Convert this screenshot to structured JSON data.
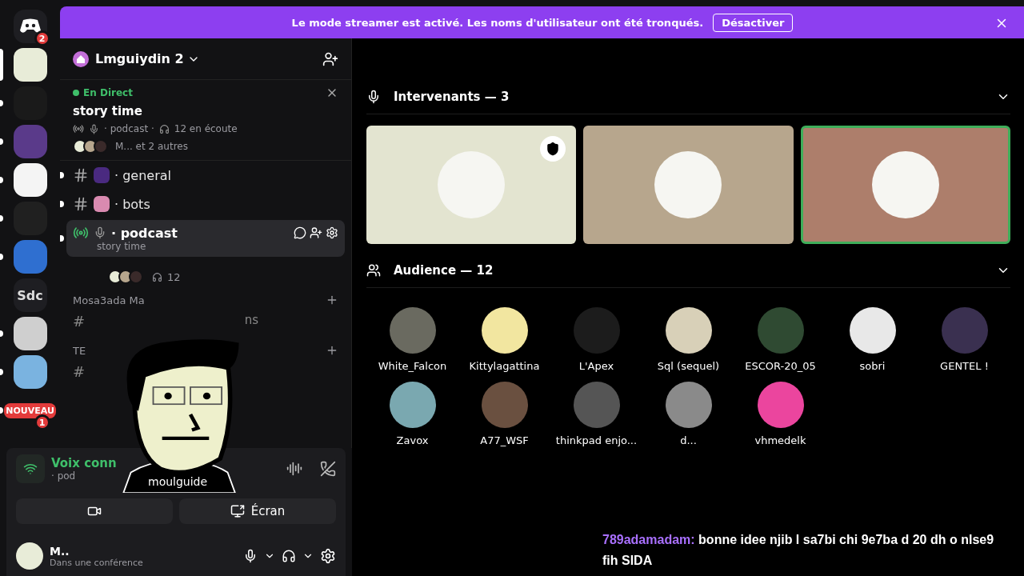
{
  "banner": {
    "text": "Le mode streamer est activé. Les noms d'utilisateur ont été tronqués.",
    "button": "Désactiver"
  },
  "servers": [
    {
      "kind": "home",
      "badge": "2",
      "unread": false,
      "selected": false
    },
    {
      "kind": "image",
      "color": "#e8ecd8",
      "unread": false,
      "selected": true
    },
    {
      "kind": "image",
      "color": "#1a1a1a",
      "unread": true,
      "selected": false
    },
    {
      "kind": "image",
      "color": "#5a3a8a",
      "unread": true,
      "selected": false
    },
    {
      "kind": "image",
      "color": "#f4f4f4",
      "unread": true,
      "selected": false
    },
    {
      "kind": "image",
      "color": "#202020",
      "unread": true,
      "selected": false
    },
    {
      "kind": "image",
      "color": "#2f6fd0",
      "unread": true,
      "selected": false
    },
    {
      "kind": "text",
      "label": "Sdc",
      "unread": false,
      "selected": false
    },
    {
      "kind": "image",
      "color": "#cfcfcf",
      "unread": true,
      "selected": false
    },
    {
      "kind": "image",
      "color": "#7ab3e0",
      "unread": true,
      "selected": false
    },
    {
      "kind": "new",
      "label": "NOUVEAU",
      "badge": "1",
      "unread": true,
      "selected": false
    }
  ],
  "sidebar": {
    "server_name": "Lmguiydin 2",
    "live": {
      "status": "En Direct",
      "title": "story time",
      "channel": "· podcast ·",
      "listeners": "12 en écoute",
      "participants": "M... et 2 autres"
    },
    "channels": [
      {
        "kind": "text",
        "name": "· general",
        "selected": false,
        "unread": true
      },
      {
        "kind": "text",
        "name": "· bots",
        "selected": false,
        "unread": true
      },
      {
        "kind": "stage",
        "name": "· podcast",
        "topic": "story time",
        "count": "12",
        "selected": true,
        "unread": true
      }
    ],
    "category_1": "Mosa3ada Ma",
    "hash_1": "#",
    "fragment": "ns",
    "category_2": "TE",
    "hash_2": "#"
  },
  "voice": {
    "status": "Voix conn",
    "channel": "· pod",
    "screen_button": "Écran"
  },
  "user": {
    "name": "M..",
    "status": "Dans une conférence"
  },
  "overlay": {
    "label": "moulguide"
  },
  "stage": {
    "speakers_title": "Intervenants — 3",
    "speakers": [
      {
        "color": "#e3e4d0",
        "moderator": true,
        "speaking": false
      },
      {
        "color": "#b7a68d",
        "moderator": false,
        "speaking": false
      },
      {
        "color": "#ad7e6b",
        "moderator": false,
        "speaking": true
      }
    ],
    "audience_title": "Audience — 12",
    "audience": [
      {
        "name": "White_Falcon",
        "color": "#6a6a60"
      },
      {
        "name": "Kittylagattina",
        "color": "#f2e6a0"
      },
      {
        "name": "L'Apex",
        "color": "#1c1c1c"
      },
      {
        "name": "Sql (sequel)",
        "color": "#d8d0b8"
      },
      {
        "name": "ESCOR-20_05",
        "color": "#2f4a32"
      },
      {
        "name": "sobri",
        "color": "#e8e8e8"
      },
      {
        "name": "GENTEL !",
        "color": "#3a3050"
      },
      {
        "name": "Zavox",
        "color": "#7aa8b0"
      },
      {
        "name": "A77_WSF",
        "color": "#6a5040"
      },
      {
        "name": "thinkpad enjo...",
        "color": "#555555"
      },
      {
        "name": "d...",
        "color": "#8a8a8a"
      },
      {
        "name": "vhmedelk",
        "color": "#eb459e"
      }
    ]
  },
  "chat": {
    "user": "789adamadam:",
    "message": "bonne idee njib l sa7bi chi 9e7ba d 20 dh o nlse9 fih SIDA"
  }
}
